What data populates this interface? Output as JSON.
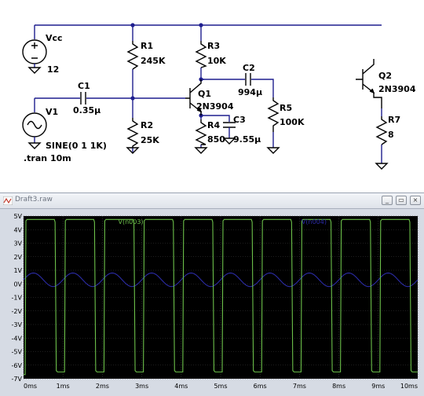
{
  "schematic": {
    "vcc": {
      "name": "Vcc",
      "value": "12"
    },
    "v1": {
      "name": "V1",
      "value": "SINE(0 1 1K)"
    },
    "directive": ".tran 10m",
    "c1": {
      "name": "C1",
      "value": "0.35µ"
    },
    "r1": {
      "name": "R1",
      "value": "245K"
    },
    "r2": {
      "name": "R2",
      "value": "25K"
    },
    "r3": {
      "name": "R3",
      "value": "10K"
    },
    "r4": {
      "name": "R4",
      "value": "850"
    },
    "c2": {
      "name": "C2",
      "value": "994µ"
    },
    "c3": {
      "name": "C3",
      "value": "9.55µ"
    },
    "r5": {
      "name": "R5",
      "value": "100K"
    },
    "q1": {
      "name": "Q1",
      "model": "2N3904"
    },
    "q2": {
      "name": "Q2",
      "model": "2N3904"
    },
    "r7": {
      "name": "R7",
      "value": "8"
    }
  },
  "plot_window": {
    "title": "Draft3.raw",
    "minimize_label": "_",
    "restore_label": "▭",
    "close_label": "×"
  },
  "chart_data": {
    "type": "line",
    "x_unit": "ms",
    "y_unit": "V",
    "xlim": [
      0,
      10
    ],
    "ylim": [
      -7,
      5
    ],
    "x_ticks": [
      "0ms",
      "1ms",
      "2ms",
      "3ms",
      "4ms",
      "5ms",
      "6ms",
      "7ms",
      "8ms",
      "9ms",
      "10ms"
    ],
    "y_ticks": [
      "5V",
      "4V",
      "3V",
      "2V",
      "1V",
      "0V",
      "-1V",
      "-2V",
      "-3V",
      "-4V",
      "-5V",
      "-6V",
      "-7V"
    ],
    "grid": true,
    "background": "#000000",
    "series": [
      {
        "name": "V(n003)",
        "color": "#6cc04a",
        "initial_low": {
          "t_end": 0.04,
          "v": -6.7
        },
        "period": 1.0,
        "high_level": 4.75,
        "low_level": -6.5,
        "high_start_offset": 0.04,
        "high_end_offset": 0.78,
        "cycles": 10
      },
      {
        "name": "V(n004)",
        "color": "#2c2ca8",
        "sine": {
          "amplitude": 0.5,
          "offset": 0.3,
          "frequency_khz": 1
        }
      }
    ]
  }
}
